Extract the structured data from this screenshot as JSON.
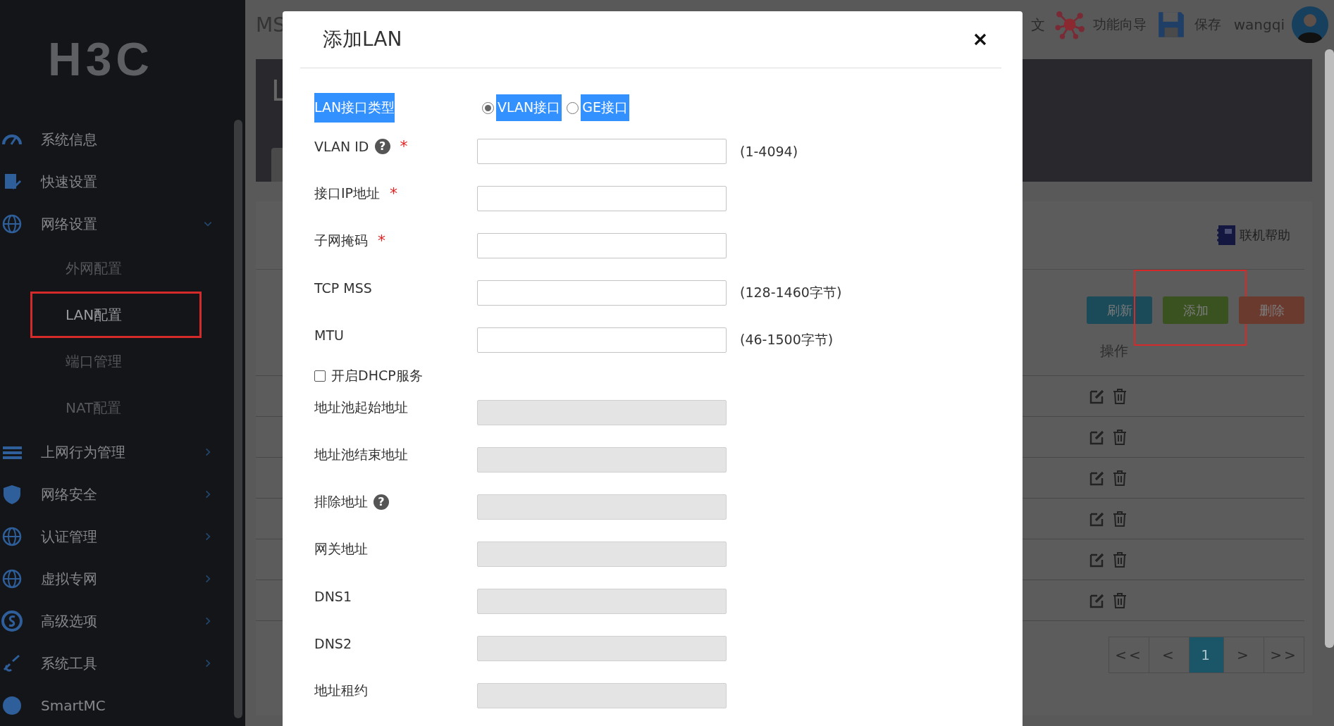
{
  "sidebar": {
    "logo": "H3C",
    "menu": [
      {
        "label": "系统信息",
        "kind": "link"
      },
      {
        "label": "快速设置",
        "kind": "link"
      },
      {
        "label": "网络设置",
        "kind": "group",
        "expanded": true,
        "children": [
          {
            "label": "外网配置",
            "selected": false,
            "annotated": false
          },
          {
            "label": "LAN配置",
            "selected": true,
            "annotated": true
          },
          {
            "label": "端口管理",
            "selected": false,
            "annotated": false
          },
          {
            "label": "NAT配置",
            "selected": false,
            "annotated": false
          }
        ]
      },
      {
        "label": "上网行为管理",
        "kind": "group",
        "expanded": false
      },
      {
        "label": "网络安全",
        "kind": "group",
        "expanded": false
      },
      {
        "label": "认证管理",
        "kind": "group",
        "expanded": false
      },
      {
        "label": "虚拟专网",
        "kind": "group",
        "expanded": false
      },
      {
        "label": "高级选项",
        "kind": "group",
        "expanded": false
      },
      {
        "label": "系统工具",
        "kind": "group",
        "expanded": false
      },
      {
        "label": "SmartMC",
        "kind": "link"
      }
    ]
  },
  "topbar": {
    "title": "MS",
    "language": "文",
    "wizard": "功能向导",
    "save": "保存",
    "user": "wangqi"
  },
  "page": {
    "heading": "L",
    "help": "联机帮助",
    "buttons": [
      {
        "label": "刷新",
        "kind": "refresh",
        "annotated": false
      },
      {
        "label": "添加",
        "kind": "add",
        "annotated": true
      },
      {
        "label": "删除",
        "kind": "delete",
        "annotated": false
      }
    ],
    "table": {
      "column": "操作",
      "rows": [
        {
          "kind": "entry"
        },
        {
          "kind": "entry"
        },
        {
          "kind": "entry"
        },
        {
          "kind": "entry"
        },
        {
          "kind": "entry"
        },
        {
          "kind": "entry"
        }
      ]
    },
    "pagination": [
      {
        "label": "<<",
        "selected": false
      },
      {
        "label": "<",
        "selected": false
      },
      {
        "label": "1",
        "selected": true
      },
      {
        "label": ">",
        "selected": false
      },
      {
        "label": ">>",
        "selected": false
      }
    ]
  },
  "dialog": {
    "title": "添加LAN",
    "interface_type": {
      "label": "LAN接口类型",
      "highlighted": true,
      "options": [
        {
          "label": "VLAN接口",
          "selected": true,
          "highlighted": true
        },
        {
          "label": "GE接口",
          "selected": false,
          "highlighted": true
        }
      ]
    },
    "fields": [
      {
        "kind": "field",
        "label": "VLAN ID",
        "help_mark": "?",
        "required_mark": "*",
        "hint": "(1-4094)",
        "disabled": false
      },
      {
        "kind": "field",
        "label": "接口IP地址",
        "required_mark": "*",
        "disabled": false
      },
      {
        "kind": "field",
        "label": "子网掩码",
        "required_mark": "*",
        "disabled": false
      },
      {
        "kind": "field",
        "label": "TCP MSS",
        "hint": "(128-1460字节)",
        "disabled": false
      },
      {
        "kind": "field",
        "label": "MTU",
        "hint": "(46-1500字节)",
        "disabled": false
      },
      {
        "kind": "checkbox",
        "label": "开启DHCP服务",
        "checked": false
      },
      {
        "kind": "field",
        "label": "地址池起始地址",
        "disabled": true
      },
      {
        "kind": "field",
        "label": "地址池结束地址",
        "disabled": true
      },
      {
        "kind": "field",
        "label": "排除地址",
        "help_mark": "?",
        "disabled": true
      },
      {
        "kind": "field",
        "label": "网关地址",
        "disabled": true
      },
      {
        "kind": "field",
        "label": "DNS1",
        "disabled": true
      },
      {
        "kind": "field",
        "label": "DNS2",
        "disabled": true
      },
      {
        "kind": "field",
        "label": "地址租约",
        "disabled": true
      }
    ]
  }
}
